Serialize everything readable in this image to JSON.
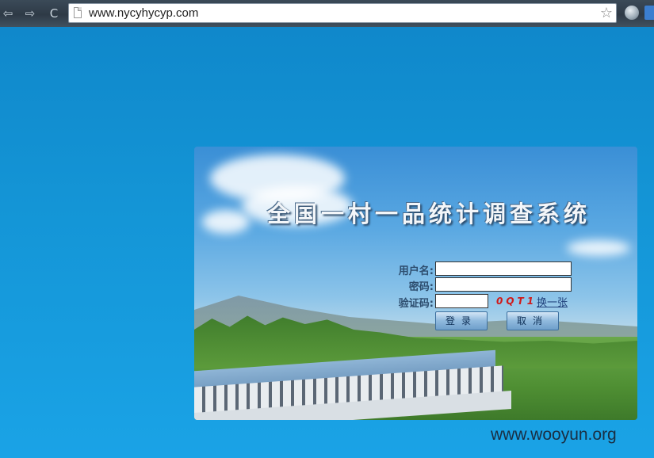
{
  "browser": {
    "url": "www.nycyhycyp.com",
    "back_glyph": "⇦",
    "forward_glyph": "⇨",
    "reload_glyph": "C",
    "star_glyph": "☆"
  },
  "login": {
    "title": "全国一村一品统计调查系统",
    "username_label": "用户名:",
    "password_label": "密码:",
    "captcha_label": "验证码:",
    "username_value": "",
    "password_value": "",
    "captcha_value": "",
    "captcha_code": "0QT1",
    "refresh_captcha": "换一张",
    "login_button": "登录",
    "cancel_button": "取消"
  },
  "watermark": "www.wooyun.org",
  "colors": {
    "background": "#1495d6",
    "captcha_text": "#d01a1a",
    "label_text": "#2d4d6e"
  }
}
